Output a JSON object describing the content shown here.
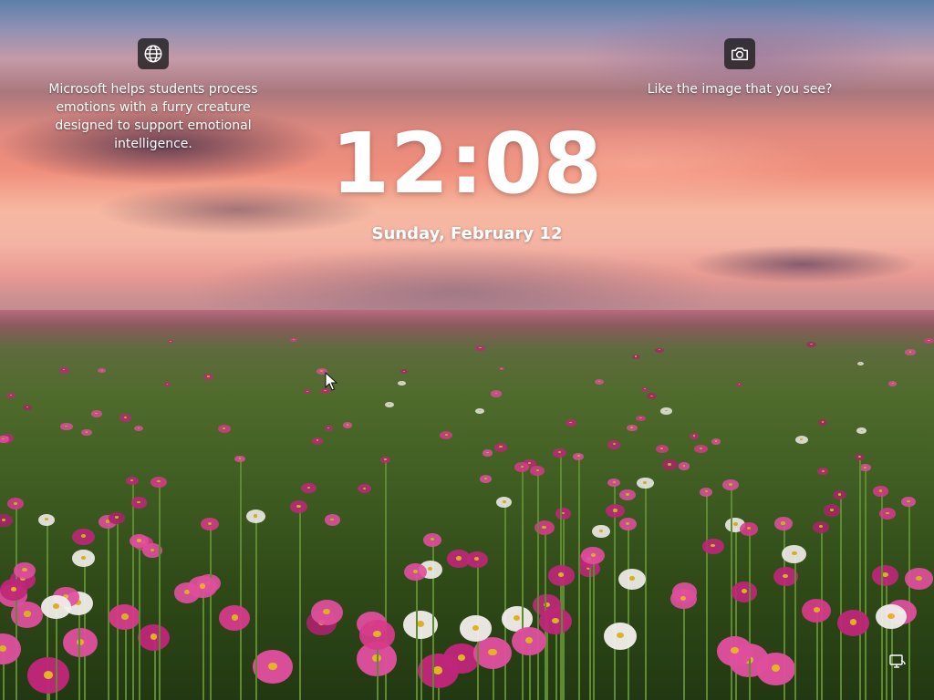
{
  "background": {
    "description": "",
    "colors": {
      "sky_top": "#5b7fa8",
      "sky_sunset": "#f08e7c",
      "field_green": "#3f5d22",
      "flower_magenta": "#c0267a",
      "flower_pink": "#e04f9e",
      "flower_white": "#f4f0ee",
      "flower_center": "#e9b827"
    }
  },
  "spotlight": {
    "info": {
      "icon": "globe-icon",
      "text": "Microsoft helps students process emotions with a furry creature designed to support emotional intelligence."
    },
    "like": {
      "icon": "camera-icon",
      "text": "Like the image that you see?"
    }
  },
  "clock": {
    "time": "12:08",
    "date": "Sunday, February 12"
  },
  "status": {
    "network_icon": "network-icon"
  }
}
